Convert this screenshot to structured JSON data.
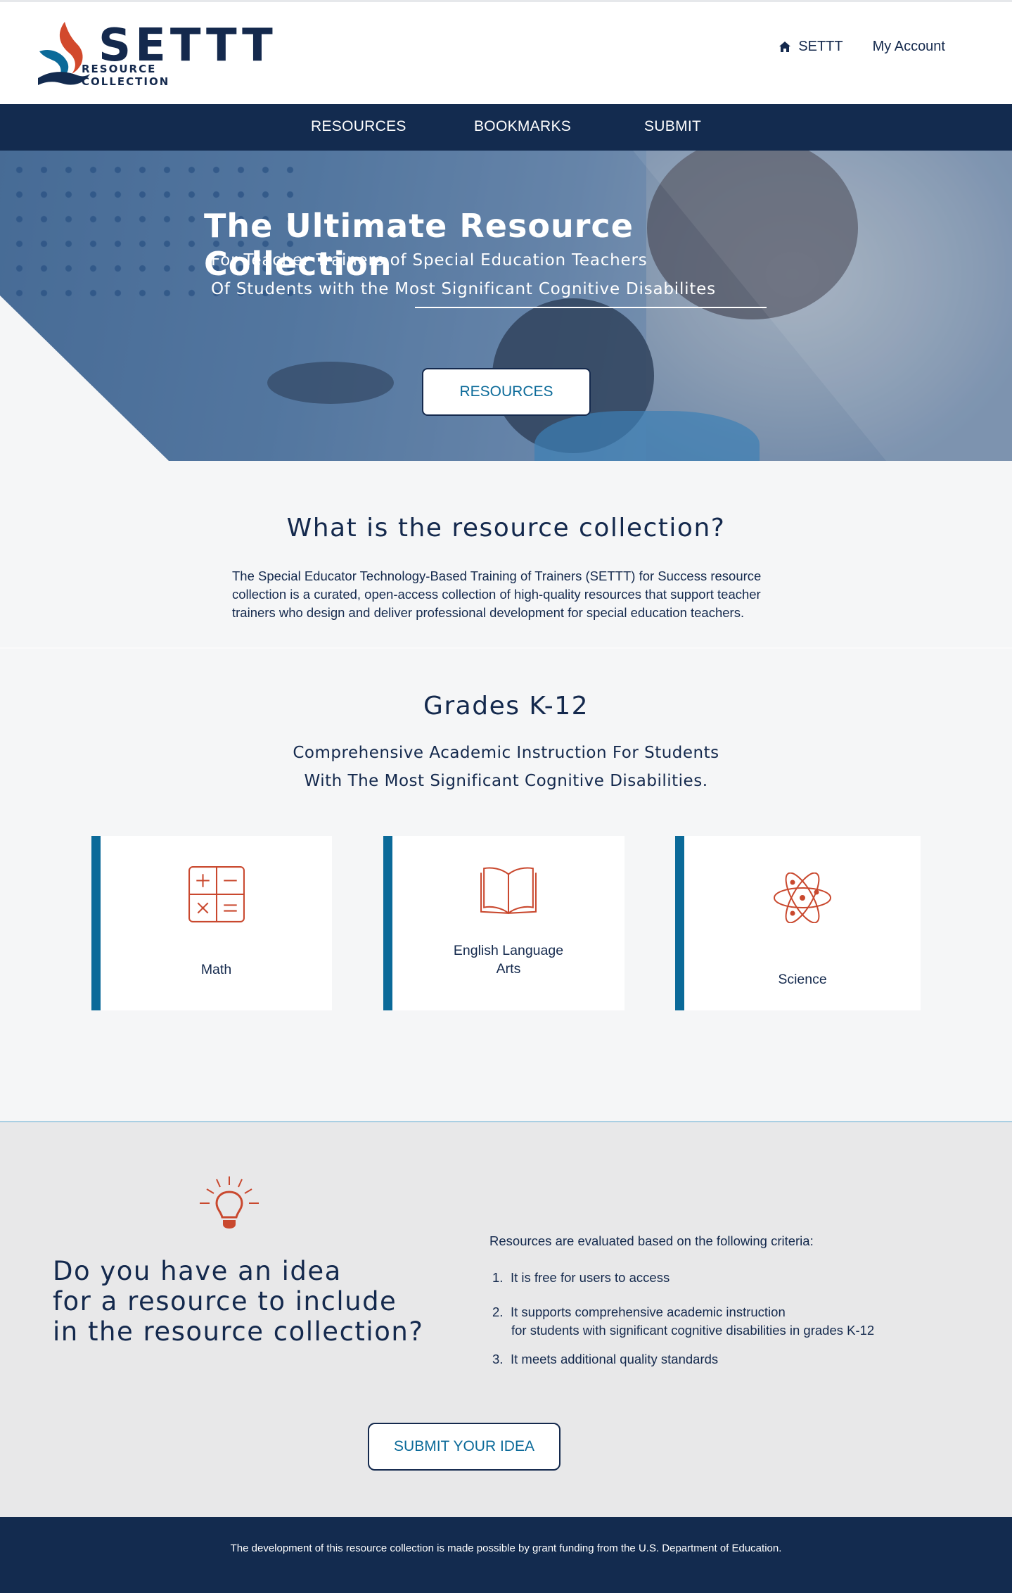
{
  "header": {
    "logo_word": "SETTT",
    "logo_subtitle": "RESOURCE COLLECTION",
    "links": [
      {
        "label": "SETTT",
        "icon": "home-icon"
      },
      {
        "label": "My Account"
      }
    ]
  },
  "navbar": {
    "items": [
      "RESOURCES",
      "BOOKMARKS",
      "SUBMIT"
    ]
  },
  "hero": {
    "title": "The Ultimate Resource Collection",
    "subtitle_line1": "For Teacher Trainers of Special Education Teachers",
    "subtitle_line2": "Of Students with the Most Significant Cognitive Disabilites",
    "button_label": "RESOURCES"
  },
  "about": {
    "title": "What is the resource collection?",
    "body": "The Special Educator Technology-Based Training of Trainers (SETTT) for Success resource collection is a curated, open-access collection of high-quality resources that support teacher trainers who design and deliver professional development for special education teachers."
  },
  "grades": {
    "title": "Grades K-12",
    "subtitle_line1": "Comprehensive Academic Instruction For Students",
    "subtitle_line2": "With The Most Significant Cognitive Disabilities.",
    "cards": [
      {
        "label": "Math",
        "icon": "calculator-icon"
      },
      {
        "label": "English Language Arts",
        "icon": "open-book-icon"
      },
      {
        "label": "Science",
        "icon": "atom-icon"
      }
    ]
  },
  "idea": {
    "icon": "lightbulb-icon",
    "title": "Do you have an idea\nfor a resource to include\nin the resource collection?",
    "criteria_intro": "Resources are  evaluated based on the following criteria:",
    "criteria": [
      {
        "num": "1.",
        "text": "It is free for users to access",
        "cont": ""
      },
      {
        "num": "2.",
        "text": "It supports comprehensive academic instruction",
        "cont": "for students with significant cognitive disabilities in grades K-12"
      },
      {
        "num": "3.",
        "text": "It meets additional quality standards",
        "cont": ""
      }
    ],
    "button_label": "SUBMIT YOUR IDEA"
  },
  "footer": {
    "text": "The development of this resource collection is made possible by grant funding from the U.S. Department of Education."
  },
  "colors": {
    "navy": "#132b4f",
    "accent_blue": "#0b6a99",
    "icon_orange": "#c9482e",
    "background": "#f5f6f7",
    "idea_background": "#e8e8e9"
  }
}
